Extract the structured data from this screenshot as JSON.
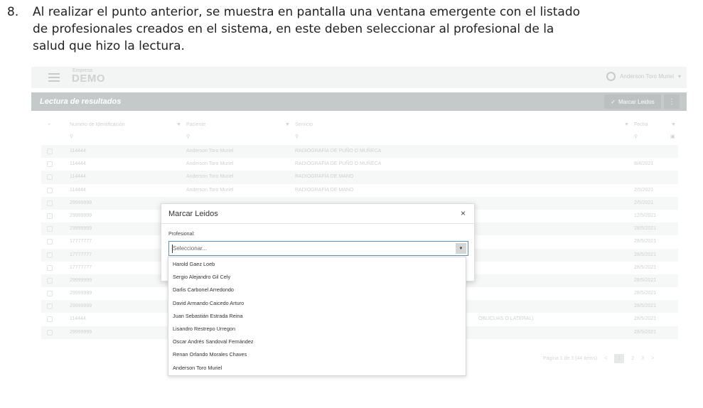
{
  "instruction": {
    "number": "8.",
    "lines": [
      "Al realizar el punto anterior, se muestra en pantalla una ventana emergente con el listado",
      "de profesionales creados en el sistema, en este deben seleccionar al profesional de la",
      "salud que hizo la lectura."
    ]
  },
  "app": {
    "brand_sub": "Empresa",
    "brand": "DEMO",
    "user_name": "Anderson Toro Muriel",
    "user_caret": "▾",
    "menu_icon": "hamburger-menu-icon",
    "user_icon": "user-circle-icon"
  },
  "panel": {
    "title": "Lectura de resultados",
    "mark_button": "Marcar Leidos",
    "mark_icon": "check-icon",
    "more_icon": "vertical-dots-icon"
  },
  "table": {
    "columns": [
      "Numero de Identificación",
      "Paciente",
      "Servicio",
      "Fecha"
    ],
    "filter_icon": "funnel-icon",
    "search_icon": "search-icon",
    "rows": [
      {
        "id": "114444",
        "patient": "Anderson Toro Muriel",
        "service": "RADIOGRAFÍA DE PUÑO O MUÑECA",
        "date": ""
      },
      {
        "id": "114444",
        "patient": "Anderson Toro Muriel",
        "service": "RADIOGRAFÍA DE PUÑO O MUÑECA",
        "date": "8/4/2021"
      },
      {
        "id": "114444",
        "patient": "Anderson Toro Muriel",
        "service": "RADIOGRAFÍA DE MANO",
        "date": ""
      },
      {
        "id": "114444",
        "patient": "Anderson Toro Muriel",
        "service": "RADIOGRAFÍA DE MANO",
        "date": "2/5/2021"
      },
      {
        "id": "29999999",
        "patient": "",
        "service": "",
        "date": "2/5/2021"
      },
      {
        "id": "29999999",
        "patient": "",
        "service": "",
        "date": "12/5/2021"
      },
      {
        "id": "29999999",
        "patient": "",
        "service": "",
        "date": "28/5/2021"
      },
      {
        "id": "17777777",
        "patient": "",
        "service": "",
        "date": "28/5/2021"
      },
      {
        "id": "17777777",
        "patient": "",
        "service": "",
        "date": "28/5/2021"
      },
      {
        "id": "17777777",
        "patient": "",
        "service": "",
        "date": "28/5/2021"
      },
      {
        "id": "29999999",
        "patient": "",
        "service": "",
        "date": "28/5/2021"
      },
      {
        "id": "29999999",
        "patient": "",
        "service": "",
        "date": "28/5/2021"
      },
      {
        "id": "29999999",
        "patient": "",
        "service": "",
        "date": "28/5/2021"
      },
      {
        "id": "114444",
        "patient": "",
        "service": "OBLICUAS O LATERAL)",
        "date": "28/5/2021"
      },
      {
        "id": "29999999",
        "patient": "",
        "service": "",
        "date": "28/5/2021"
      }
    ]
  },
  "pager": {
    "info": "Página 1 de 3 (44 items)",
    "prev": "<",
    "pages": [
      "1",
      "2",
      "3"
    ],
    "next": ">"
  },
  "modal": {
    "title": "Marcar Leidos",
    "close": "×",
    "label": "Profesional:",
    "placeholder": "Seleccionar...",
    "arrow_icon": "dropdown-arrow-icon",
    "options": [
      "Harold Gaez Loeb",
      "Sergio Alejandro Gil Cely",
      "Darlis Carbonel Arredondo",
      "David Armando Caicedo Arturo",
      "Juan Sebastián Estrada Reina",
      "Lisandro Restrepo Urregon",
      "Oscar Andrés Sandoval Fernández",
      "Renan Orlando Morales Chaves",
      "Anderson Toro Muriel"
    ]
  }
}
